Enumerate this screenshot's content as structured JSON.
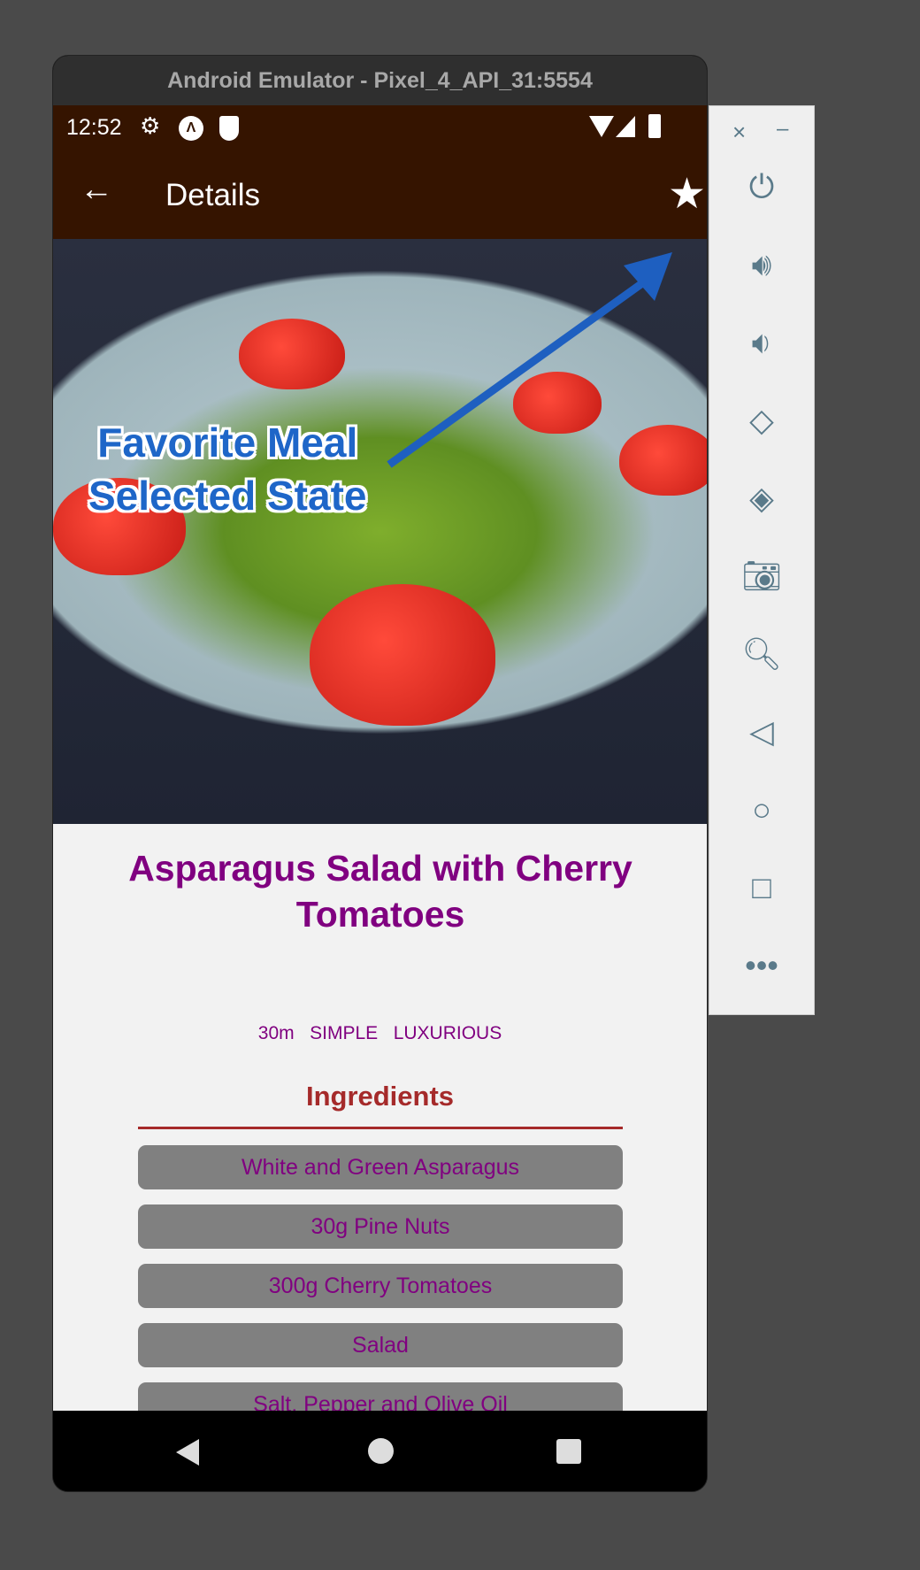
{
  "window": {
    "title": "Android Emulator - Pixel_4_API_31:5554"
  },
  "status_bar": {
    "time": "12:52",
    "icons": [
      "gear-icon",
      "a-icon",
      "shield-icon",
      "wifi-icon",
      "signal-icon",
      "battery-icon"
    ]
  },
  "app_bar": {
    "title": "Details",
    "back_icon": "arrow-left-icon",
    "favorite_icon": "star-filled-icon"
  },
  "annotation": {
    "line1": "Favorite Meal",
    "line2": "Selected State",
    "color": "#1e66c8"
  },
  "meal": {
    "title": "Asparagus Salad with Cherry Tomatoes",
    "duration": "30m",
    "complexity": "SIMPLE",
    "affordability": "LUXURIOUS"
  },
  "ingredients": {
    "heading": "Ingredients",
    "items": [
      "White and Green Asparagus",
      "30g Pine Nuts",
      "300g Cherry Tomatoes",
      "Salad",
      "Salt, Pepper and Olive Oil"
    ]
  },
  "colors": {
    "primary": "#351400",
    "title": "#800080",
    "heading": "#a52a2a",
    "item_bg": "#808080"
  },
  "side_toolbar": {
    "close": "×",
    "minimize": "–"
  }
}
